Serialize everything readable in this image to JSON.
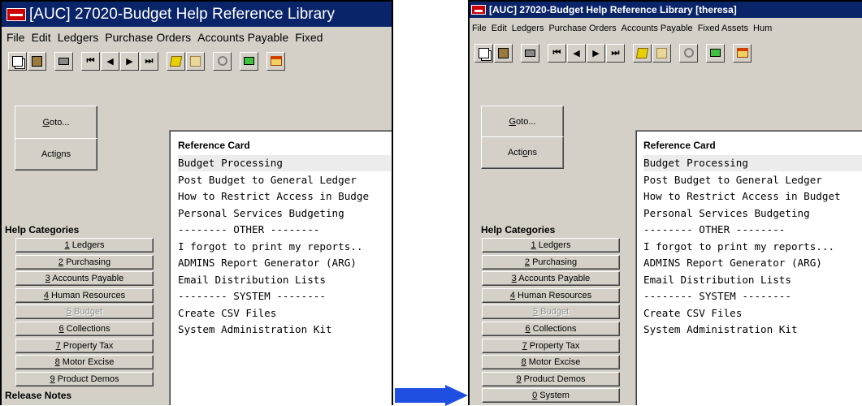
{
  "left": {
    "title": "[AUC] 27020-Budget Help Reference Library",
    "menu": [
      "File",
      "Edit",
      "Ledgers",
      "Purchase Orders",
      "Accounts Payable",
      "Fixed"
    ],
    "goto_label": "Goto...",
    "actions_label": "Actions",
    "help_categories_heading": "Help Categories",
    "categories": [
      {
        "num": "1",
        "label": " Ledgers",
        "disabled": false
      },
      {
        "num": "2",
        "label": " Purchasing",
        "disabled": false
      },
      {
        "num": "3",
        "label": " Accounts Payable",
        "disabled": false
      },
      {
        "num": "4",
        "label": " Human Resources",
        "disabled": false
      },
      {
        "num": "5",
        "label": " Budget",
        "disabled": true
      },
      {
        "num": "6",
        "label": " Collections",
        "disabled": false
      },
      {
        "num": "7",
        "label": " Property Tax",
        "disabled": false
      },
      {
        "num": "8",
        "label": " Motor Excise",
        "disabled": false
      },
      {
        "num": "9",
        "label": " Product Demos",
        "disabled": false
      }
    ],
    "release_notes_heading": "Release Notes",
    "reference_card_title": "Reference Card",
    "reference_items": [
      "Budget Processing",
      "Post Budget to General Ledger",
      "How to Restrict Access in Budge",
      "Personal Services Budgeting",
      "-------- OTHER --------",
      "I forgot to print my reports..",
      "ADMINS Report Generator (ARG)",
      "Email Distribution Lists",
      "-------- SYSTEM --------",
      "Create CSV Files",
      "System Administration Kit"
    ]
  },
  "right": {
    "title": "[AUC] 27020-Budget Help Reference Library [theresa]",
    "menu": [
      "File",
      "Edit",
      "Ledgers",
      "Purchase Orders",
      "Accounts Payable",
      "Fixed Assets",
      "Hum"
    ],
    "goto_label": "Goto...",
    "actions_label": "Actions",
    "help_categories_heading": "Help Categories",
    "categories": [
      {
        "num": "1",
        "label": " Ledgers",
        "disabled": false
      },
      {
        "num": "2",
        "label": " Purchasing",
        "disabled": false
      },
      {
        "num": "3",
        "label": " Accounts Payable",
        "disabled": false
      },
      {
        "num": "4",
        "label": " Human Resources",
        "disabled": false
      },
      {
        "num": "5",
        "label": " Budget",
        "disabled": true
      },
      {
        "num": "6",
        "label": " Collections",
        "disabled": false
      },
      {
        "num": "7",
        "label": " Property Tax",
        "disabled": false
      },
      {
        "num": "8",
        "label": " Motor Excise",
        "disabled": false
      },
      {
        "num": "9",
        "label": " Product Demos",
        "disabled": false
      },
      {
        "num": "0",
        "label": " System",
        "disabled": false
      }
    ],
    "reference_card_title": "Reference Card",
    "reference_items": [
      "Budget Processing",
      "Post Budget to General Ledger",
      "How to Restrict Access in Budget",
      "Personal Services Budgeting",
      "-------- OTHER --------",
      "I forgot to print my reports...",
      "ADMINS Report Generator (ARG)",
      "Email Distribution Lists",
      "-------- SYSTEM --------",
      "Create CSV Files",
      "System Administration Kit"
    ]
  },
  "toolbar_icons": [
    "copy-icon",
    "paste-icon",
    "print-icon",
    "first-record-icon",
    "previous-record-icon",
    "next-record-icon",
    "last-record-icon",
    "edit-icon",
    "edit-disabled-icon",
    "search-icon",
    "excel-icon",
    "home-icon"
  ],
  "colors": {
    "titlebar": "#0a246a",
    "window": "#d4d0c8",
    "arrow": "#1f4fe0"
  }
}
